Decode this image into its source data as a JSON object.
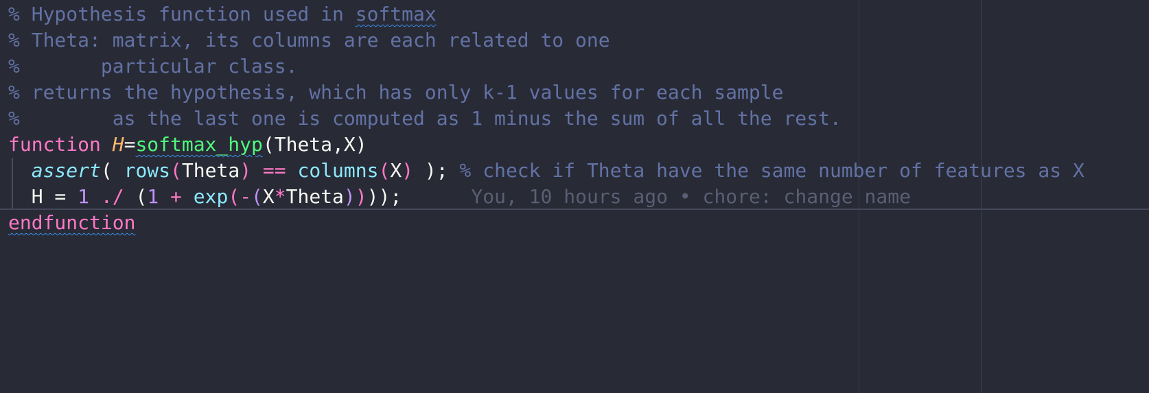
{
  "editor": {
    "lines": [
      {
        "comment": "% Hypothesis function used in ",
        "squiggle_word": "softmax"
      },
      {
        "comment": "% Theta: matrix, its columns are each related to one"
      },
      {
        "comment": "%       particular class."
      },
      {
        "comment": "% returns the hypothesis, which has only k-1 values for each sample"
      },
      {
        "comment": "%        as the last one is computed as 1 minus the sum of all the rest."
      },
      {
        "kw_function": "function",
        "space": " ",
        "output_var": "H",
        "equals": "=",
        "fn_name": "softmax_hyp",
        "params": "(Theta,X)"
      },
      {
        "indent": "  ",
        "assert": "assert",
        "open": "( ",
        "rows": "rows",
        "lp1": "(",
        "theta1": "Theta",
        "rp1": ")",
        "eq": " == ",
        "columns": "columns",
        "lp2": "(",
        "x1": "X",
        "rp2": ")",
        "close": " ); ",
        "comment": "% check if Theta have the same number of features as X"
      },
      {
        "indent": "  ",
        "lhs": "H = ",
        "one1": "1",
        "div": " ./ ",
        "lp_outer": "(",
        "one2": "1",
        "plus": " + ",
        "exp": "exp",
        "lp_exp": "(",
        "minus": "-",
        "lp_in": "(",
        "x2": "X",
        "star": "*",
        "theta2": "Theta",
        "rp_in": ")",
        "rp_exp": ")",
        "rp_outer": ")",
        "end": ");",
        "blame_gap": "      ",
        "blame": "You, 10 hours ago • chore: change name"
      },
      {
        "kw_endfunction": "endfunction"
      }
    ]
  },
  "colors": {
    "background": "#282a36",
    "comment": "#6272a4",
    "keyword": "#ff79c6",
    "function_name": "#50fa7b",
    "builtin": "#8be9fd",
    "number": "#bd93f9",
    "output_var": "#ffb86c",
    "blame": "#5a5f73",
    "squiggle": "#3b8eea"
  }
}
